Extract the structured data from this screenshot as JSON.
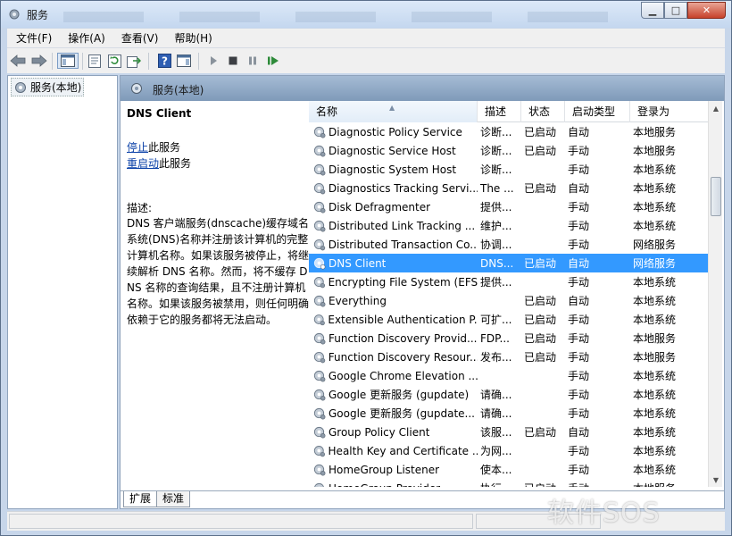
{
  "window": {
    "title": "服务"
  },
  "menu": [
    "文件(F)",
    "操作(A)",
    "查看(V)",
    "帮助(H)"
  ],
  "tree": {
    "root": "服务(本地)"
  },
  "header": {
    "title": "服务(本地)"
  },
  "detail": {
    "service_name": "DNS Client",
    "stop_link": "停止",
    "stop_suffix": "此服务",
    "restart_link": "重启动",
    "restart_suffix": "此服务",
    "desc_label": "描述:",
    "description": "DNS 客户端服务(dnscache)缓存域名系统(DNS)名称并注册该计算机的完整计算机名称。如果该服务被停止，将继续解析 DNS 名称。然而，将不缓存 DNS 名称的查询结果，且不注册计算机名称。如果该服务被禁用，则任何明确依赖于它的服务都将无法启动。"
  },
  "columns": [
    "名称",
    "描述",
    "状态",
    "启动类型",
    "登录为"
  ],
  "rows": [
    {
      "name": "Diagnostic Policy Service",
      "desc": "诊断...",
      "status": "已启动",
      "startup": "自动",
      "logon": "本地服务"
    },
    {
      "name": "Diagnostic Service Host",
      "desc": "诊断...",
      "status": "已启动",
      "startup": "手动",
      "logon": "本地服务"
    },
    {
      "name": "Diagnostic System Host",
      "desc": "诊断...",
      "status": "",
      "startup": "手动",
      "logon": "本地系统"
    },
    {
      "name": "Diagnostics Tracking Servi...",
      "desc": "The ...",
      "status": "已启动",
      "startup": "自动",
      "logon": "本地系统"
    },
    {
      "name": "Disk Defragmenter",
      "desc": "提供...",
      "status": "",
      "startup": "手动",
      "logon": "本地系统"
    },
    {
      "name": "Distributed Link Tracking ...",
      "desc": "维护...",
      "status": "",
      "startup": "手动",
      "logon": "本地系统"
    },
    {
      "name": "Distributed Transaction Co...",
      "desc": "协调...",
      "status": "",
      "startup": "手动",
      "logon": "网络服务"
    },
    {
      "name": "DNS Client",
      "desc": "DNS...",
      "status": "已启动",
      "startup": "自动",
      "logon": "网络服务",
      "selected": true
    },
    {
      "name": "Encrypting File System (EFS)",
      "desc": "提供...",
      "status": "",
      "startup": "手动",
      "logon": "本地系统"
    },
    {
      "name": "Everything",
      "desc": "",
      "status": "已启动",
      "startup": "自动",
      "logon": "本地系统"
    },
    {
      "name": "Extensible Authentication P...",
      "desc": "可扩...",
      "status": "已启动",
      "startup": "手动",
      "logon": "本地系统"
    },
    {
      "name": "Function Discovery Provid...",
      "desc": "FDP...",
      "status": "已启动",
      "startup": "手动",
      "logon": "本地服务"
    },
    {
      "name": "Function Discovery Resour...",
      "desc": "发布...",
      "status": "已启动",
      "startup": "手动",
      "logon": "本地服务"
    },
    {
      "name": "Google Chrome Elevation ...",
      "desc": "",
      "status": "",
      "startup": "手动",
      "logon": "本地系统"
    },
    {
      "name": "Google 更新服务 (gupdate)",
      "desc": "请确...",
      "status": "",
      "startup": "手动",
      "logon": "本地系统"
    },
    {
      "name": "Google 更新服务 (gupdate...",
      "desc": "请确...",
      "status": "",
      "startup": "手动",
      "logon": "本地系统"
    },
    {
      "name": "Group Policy Client",
      "desc": "该服...",
      "status": "已启动",
      "startup": "自动",
      "logon": "本地系统"
    },
    {
      "name": "Health Key and Certificate ...",
      "desc": "为网...",
      "status": "",
      "startup": "手动",
      "logon": "本地系统"
    },
    {
      "name": "HomeGroup Listener",
      "desc": "使本...",
      "status": "",
      "startup": "手动",
      "logon": "本地系统"
    },
    {
      "name": "HomeGroup Provider",
      "desc": "执行...",
      "status": "已启动",
      "startup": "手动",
      "logon": "本地服务"
    }
  ],
  "tabs": [
    "扩展",
    "标准"
  ],
  "watermark": "软件SOS",
  "colors": {
    "selection": "#3399ff",
    "link": "#0b41a8",
    "header_band": "#8fa8c6"
  }
}
